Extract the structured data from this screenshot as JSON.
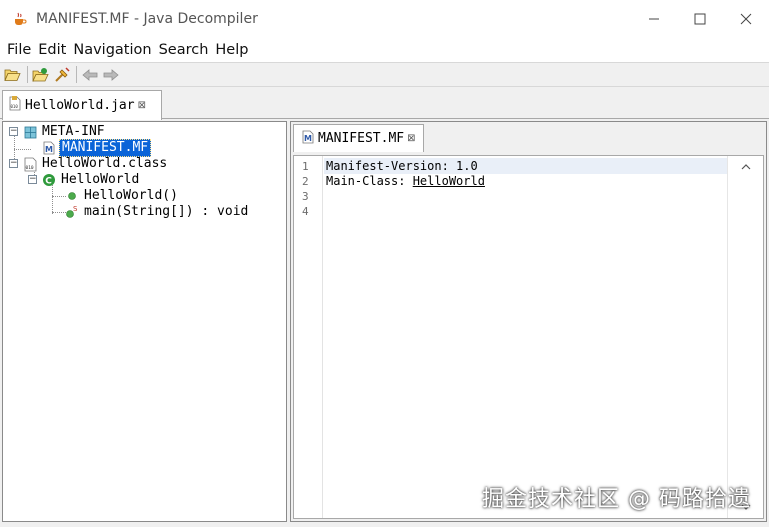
{
  "window": {
    "title": "MANIFEST.MF - Java Decompiler",
    "controls": [
      "minimize-icon",
      "maximize-icon",
      "close-icon"
    ]
  },
  "menu": [
    "File",
    "Edit",
    "Navigation",
    "Search",
    "Help"
  ],
  "toolbar": {
    "buttons": [
      "open-file-icon",
      "open-type-icon",
      "search-icon",
      "back-icon",
      "forward-icon"
    ]
  },
  "file_tab": {
    "label": "HelloWorld.jar",
    "icon": "jar-file-icon"
  },
  "tree": {
    "nodes": [
      {
        "label": "META-INF",
        "icon": "package-icon",
        "expander": "−"
      },
      {
        "label": "MANIFEST.MF",
        "icon": "manifest-file-icon",
        "selected": true
      },
      {
        "label": "HelloWorld.class",
        "icon": "class-file-icon",
        "expander": "−"
      },
      {
        "label": "HelloWorld",
        "icon": "class-icon",
        "expander": "−"
      },
      {
        "label": "HelloWorld()",
        "icon": "method-icon"
      },
      {
        "label": "main(String[]) : void",
        "icon": "static-method-icon",
        "badge": "S"
      }
    ]
  },
  "editor": {
    "tab": {
      "label": "MANIFEST.MF",
      "icon": "manifest-file-icon"
    },
    "lines": [
      {
        "no": "1",
        "text": "Manifest-Version: 1.0",
        "link": ""
      },
      {
        "no": "2",
        "text": "Main-Class: ",
        "link": "HelloWorld"
      },
      {
        "no": "3",
        "text": "",
        "link": ""
      },
      {
        "no": "4",
        "text": "",
        "link": ""
      }
    ]
  },
  "watermark": "掘金技术社区 @ 码路拾遗",
  "colors": {
    "selection": "#0a64d8",
    "current_line": "#e9eff8",
    "class_icon": "#2f9a3c",
    "package_icon": "#3c8fb0"
  }
}
